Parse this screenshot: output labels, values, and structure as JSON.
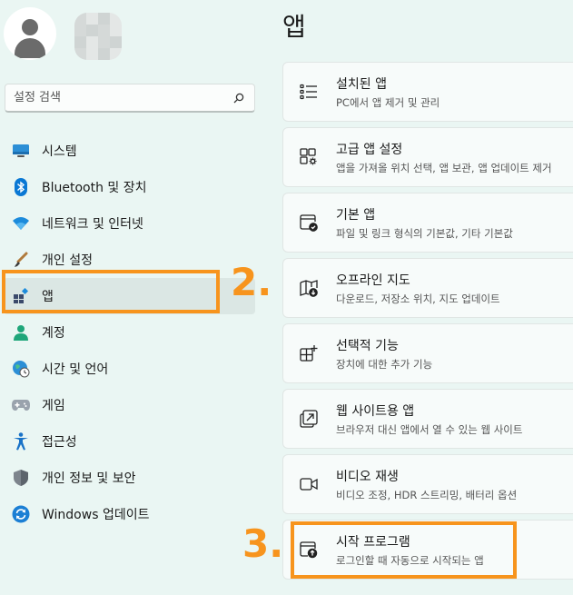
{
  "search": {
    "placeholder": "설정 검색"
  },
  "nav": {
    "items": [
      {
        "label": "시스템",
        "icon": "monitor-icon"
      },
      {
        "label": "Bluetooth 및 장치",
        "icon": "bluetooth-icon"
      },
      {
        "label": "네트워크 및 인터넷",
        "icon": "wifi-icon"
      },
      {
        "label": "개인 설정",
        "icon": "brush-icon"
      },
      {
        "label": "앱",
        "icon": "apps-icon"
      },
      {
        "label": "계정",
        "icon": "person-icon"
      },
      {
        "label": "시간 및 언어",
        "icon": "globe-clock-icon"
      },
      {
        "label": "게임",
        "icon": "gamepad-icon"
      },
      {
        "label": "접근성",
        "icon": "accessibility-icon"
      },
      {
        "label": "개인 정보 및 보안",
        "icon": "shield-icon"
      },
      {
        "label": "Windows 업데이트",
        "icon": "update-icon"
      }
    ]
  },
  "main": {
    "title": "앱",
    "cards": [
      {
        "title": "설치된 앱",
        "subtitle": "PC에서 앱 제거 및 관리",
        "icon": "list-icon"
      },
      {
        "title": "고급 앱 설정",
        "subtitle": "앱을 가져올 위치 선택, 앱 보관, 앱 업데이트 제거",
        "icon": "app-settings-icon"
      },
      {
        "title": "기본 앱",
        "subtitle": "파일 및 링크 형식의 기본값, 기타 기본값",
        "icon": "default-apps-icon"
      },
      {
        "title": "오프라인 지도",
        "subtitle": "다운로드, 저장소 위치, 지도 업데이트",
        "icon": "map-download-icon"
      },
      {
        "title": "선택적 기능",
        "subtitle": "장치에 대한 추가 기능",
        "icon": "add-grid-icon"
      },
      {
        "title": "웹 사이트용 앱",
        "subtitle": "브라우저 대신 앱에서 열 수 있는 웹 사이트",
        "icon": "open-in-app-icon"
      },
      {
        "title": "비디오 재생",
        "subtitle": "비디오 조정, HDR 스트리밍, 배터리 옵션",
        "icon": "video-icon"
      },
      {
        "title": "시작 프로그램",
        "subtitle": "로그인할 때 자동으로 시작되는 앱",
        "icon": "startup-icon"
      }
    ]
  },
  "annotations": {
    "step2": "2.",
    "step3": "3."
  },
  "colors": {
    "accent": "#f7941d",
    "background": "#eaf6f3",
    "icon_blue": "#0067c0"
  }
}
